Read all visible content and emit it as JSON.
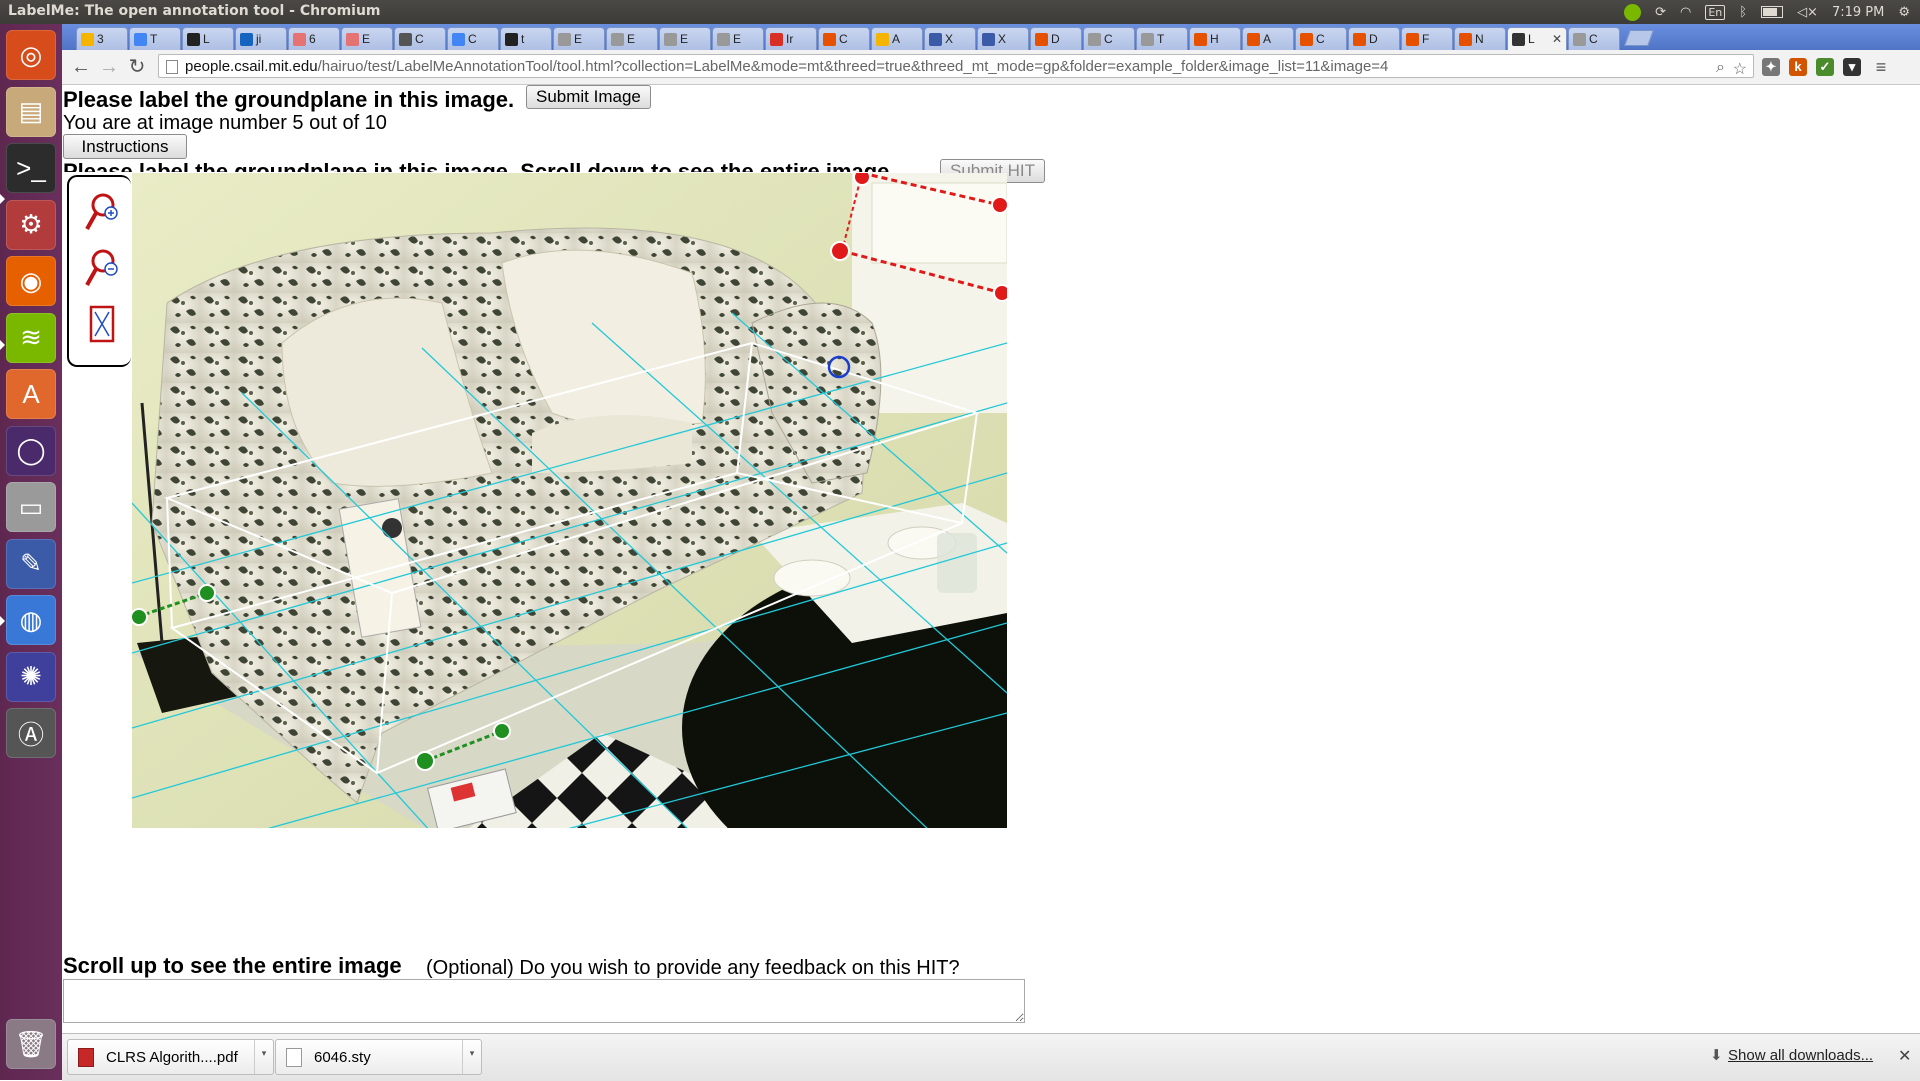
{
  "system": {
    "window_title": "LabelMe: The open annotation tool - Chromium",
    "keyboard_layout": "En",
    "clock": "7:19 PM"
  },
  "launcher": {
    "items": [
      {
        "name": "ubuntu-dash",
        "glyph": "◎",
        "color": "#d64c1b"
      },
      {
        "name": "files",
        "glyph": "▤",
        "color": "#c8a97a"
      },
      {
        "name": "terminal",
        "glyph": ">_",
        "color": "#2c2c2c"
      },
      {
        "name": "system-settings",
        "glyph": "⚙",
        "color": "#b23b3b"
      },
      {
        "name": "firefox",
        "glyph": "◉",
        "color": "#e66000"
      },
      {
        "name": "spotify",
        "glyph": "≋",
        "color": "#7ab800"
      },
      {
        "name": "software-center",
        "glyph": "A",
        "color": "#e0682c"
      },
      {
        "name": "unity-tweak",
        "glyph": "◯",
        "color": "#4a2a6b"
      },
      {
        "name": "disk",
        "glyph": "▭",
        "color": "#9a9a9a"
      },
      {
        "name": "pencil-app",
        "glyph": "✎",
        "color": "#3b5aa8"
      },
      {
        "name": "chromium",
        "glyph": "◍",
        "color": "#3a78d8"
      },
      {
        "name": "shutter",
        "glyph": "✺",
        "color": "#3f3f9c"
      },
      {
        "name": "updater",
        "glyph": "Ⓐ",
        "color": "#555"
      }
    ],
    "trash_glyph": "🗑"
  },
  "tabs": [
    {
      "label": "3",
      "color": "#f4b400"
    },
    {
      "label": "T",
      "color": "#4285f4"
    },
    {
      "label": "L",
      "color": "#222222"
    },
    {
      "label": "ji",
      "color": "#1565c0"
    },
    {
      "label": "6",
      "color": "#e57373"
    },
    {
      "label": "E",
      "color": "#e57373"
    },
    {
      "label": "C",
      "color": "#555555"
    },
    {
      "label": "C",
      "color": "#4285f4"
    },
    {
      "label": "t",
      "color": "#222222"
    },
    {
      "label": "E",
      "color": "#999999"
    },
    {
      "label": "E",
      "color": "#999999"
    },
    {
      "label": "E",
      "color": "#999999"
    },
    {
      "label": "E",
      "color": "#999999"
    },
    {
      "label": "Ir",
      "color": "#d93025"
    },
    {
      "label": "C",
      "color": "#e65100"
    },
    {
      "label": "A",
      "color": "#f4b400"
    },
    {
      "label": "X",
      "color": "#3b5aa8"
    },
    {
      "label": "X",
      "color": "#3b5aa8"
    },
    {
      "label": "D",
      "color": "#e65100"
    },
    {
      "label": "C",
      "color": "#999999"
    },
    {
      "label": "T",
      "color": "#999999"
    },
    {
      "label": "H",
      "color": "#e65100"
    },
    {
      "label": "A",
      "color": "#e65100"
    },
    {
      "label": "C",
      "color": "#e65100"
    },
    {
      "label": "D",
      "color": "#e65100"
    },
    {
      "label": "F",
      "color": "#e65100"
    },
    {
      "label": "N",
      "color": "#e65100"
    },
    {
      "label": "L",
      "color": "#333333",
      "active": true
    },
    {
      "label": "C",
      "color": "#999999"
    }
  ],
  "address_bar": {
    "host": "people.csail.mit.edu",
    "path": "/hairuo/test/LabelMeAnnotationTool/tool.html?collection=LabelMe&mode=mt&threed=true&threed_mt_mode=gp&folder=example_folder&image_list=11&image=4"
  },
  "page": {
    "instruction_top": "Please label the groundplane in this image.",
    "submit_image": "Submit Image",
    "image_counter": "You are at image number 5 out of 10",
    "instructions_button": "Instructions",
    "instruction_second": "Please label the groundplane in this image. Scroll down to see the entire image.",
    "submit_hit": "Submit HIT",
    "scroll_up": "Scroll up to see the entire image",
    "feedback_question": "(Optional) Do you wish to provide any feedback on this HIT?",
    "feedback_value": ""
  },
  "annotation_colors": {
    "groundplane_grid": "#22c8d8",
    "box_edges": "#ffffff",
    "red_points": "#e01919",
    "green_points": "#1f8f1f",
    "blue_handle": "#1a3fd0"
  },
  "downloads": [
    {
      "name": "CLRS Algorith....pdf",
      "type": "pdf"
    },
    {
      "name": "6046.sty",
      "type": "file"
    }
  ],
  "shelf": {
    "show_all": "Show all downloads..."
  }
}
